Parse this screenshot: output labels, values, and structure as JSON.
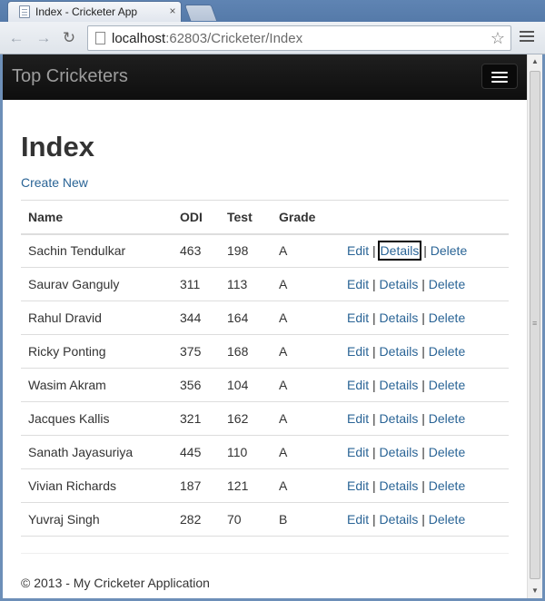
{
  "browser": {
    "tab_title": "Index - Cricketer App",
    "tab_close": "×",
    "url_host": "localhost",
    "url_rest": ":62803/Cricketer/Index"
  },
  "app": {
    "brand": "Top Cricketers",
    "page_title": "Index",
    "create_label": "Create New",
    "footer": "© 2013 - My Cricketer Application"
  },
  "table": {
    "headers": [
      "Name",
      "ODI",
      "Test",
      "Grade"
    ],
    "rows": [
      {
        "name": "Sachin Tendulkar",
        "odi": "463",
        "test": "198",
        "grade": "A"
      },
      {
        "name": "Saurav Ganguly",
        "odi": "311",
        "test": "113",
        "grade": "A"
      },
      {
        "name": "Rahul Dravid",
        "odi": "344",
        "test": "164",
        "grade": "A"
      },
      {
        "name": "Ricky Ponting",
        "odi": "375",
        "test": "168",
        "grade": "A"
      },
      {
        "name": "Wasim Akram",
        "odi": "356",
        "test": "104",
        "grade": "A"
      },
      {
        "name": "Jacques Kallis",
        "odi": "321",
        "test": "162",
        "grade": "A"
      },
      {
        "name": "Sanath Jayasuriya",
        "odi": "445",
        "test": "110",
        "grade": "A"
      },
      {
        "name": "Vivian Richards",
        "odi": "187",
        "test": "121",
        "grade": "A"
      },
      {
        "name": "Yuvraj Singh",
        "odi": "282",
        "test": "70",
        "grade": "B"
      }
    ],
    "actions": {
      "edit": "Edit",
      "details": "Details",
      "delete": "Delete",
      "separator": "|"
    }
  },
  "colors": {
    "link": "#2a6496",
    "navbar": "#1a1a1a"
  }
}
